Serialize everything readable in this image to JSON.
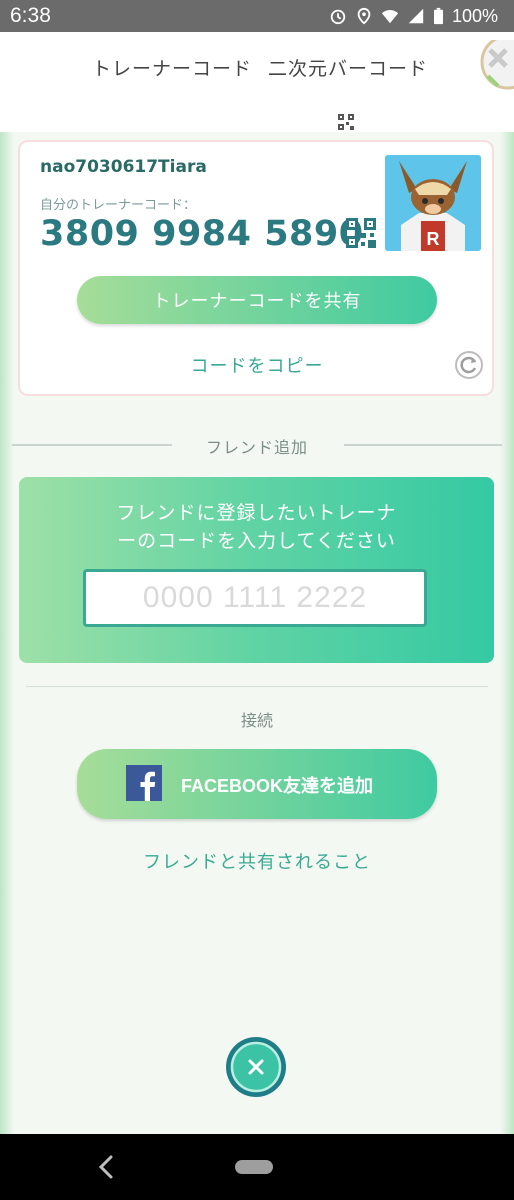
{
  "status_bar": {
    "time": "6:38",
    "battery": "100%",
    "icons": [
      "alarm-icon",
      "location-icon",
      "wifi-icon",
      "signal-icon",
      "battery-icon"
    ]
  },
  "tabs": [
    {
      "label": "トレーナーコード",
      "selected": true
    },
    {
      "label": "二次元バーコード",
      "selected": false
    }
  ],
  "trainer_card": {
    "username": "nao7030617Tiara",
    "code_label": "自分のトレーナーコード：",
    "code": "3809 9984 5890",
    "share_button": "トレーナーコードを共有",
    "copy_link": "コードをコピー"
  },
  "add_friend": {
    "section_title": "フレンド追加",
    "prompt_line1": "フレンドに登録したいトレーナ",
    "prompt_line2": "ーのコードを入力してください",
    "input_placeholder": "0000 1111 2222",
    "input_value": ""
  },
  "connect": {
    "section_title": "接続",
    "facebook_button": "FACEBOOK友達を追加",
    "shared_link": "フレンドと共有されること"
  },
  "colors": {
    "accent": "#3aa993",
    "code_text": "#2b7a82",
    "panel_start": "#9ee0a7",
    "panel_end": "#35c9a3",
    "facebook": "#3b5998"
  }
}
